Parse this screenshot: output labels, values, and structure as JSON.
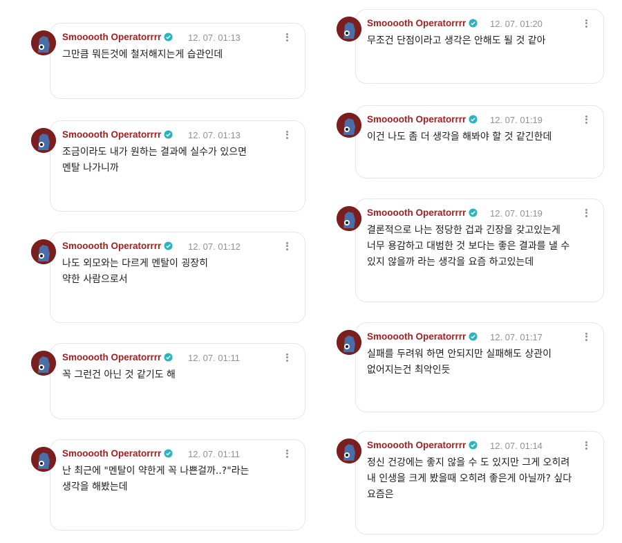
{
  "user": {
    "name": "Smooooth Operatorrrr"
  },
  "left_column": [
    {
      "time": "12. 07. 01:13",
      "text": "그만큼 뭐든것에 철저해지는게 습관인데"
    },
    {
      "time": "12. 07. 01:13",
      "text": "조금이라도 내가 원하는 결과에 실수가 있으면\n멘탈 나가니까"
    },
    {
      "time": "12. 07. 01:12",
      "text": "나도 외모와는 다르게 멘탈이 굉장히\n약한 사람으로서"
    },
    {
      "time": "12. 07. 01:11",
      "text": "꼭 그런건 아닌 것 같기도 해"
    },
    {
      "time": "12. 07. 01:11",
      "text": "난 최근에 \"멘탈이 약한게 꼭 나쁜걸까..?\"라는\n생각을 해봤는데"
    }
  ],
  "right_column": [
    {
      "time": "12. 07. 01:20",
      "text": "무조건 단점이라고 생각은 안해도 될 것 같아"
    },
    {
      "time": "12. 07. 01:19",
      "text": "이건 나도 좀 더 생각을 해봐야 할 것 같긴한데"
    },
    {
      "time": "12. 07. 01:19",
      "text": "결론적으로 나는 정당한 겁과 긴장을 갖고있는게\n너무 용감하고 대범한 것 보다는 좋은 결과를 낼 수\n있지 않을까 라는 생각을 요즘 하고있는데"
    },
    {
      "time": "12. 07. 01:17",
      "text": "실패를 두려워 하면 안되지만 실패해도 상관이\n없어지는건 최악인듯"
    },
    {
      "time": "12. 07. 01:14",
      "text": "정신 건강에는 좋지 않을 수 도 있지만 그게 오히려\n내 인생을 크게 봤을때 오히려 좋은게 아닐까? 싶다\n요즘은"
    }
  ],
  "colors": {
    "name": "#a31f1f",
    "verified": "#2bb3c0",
    "time": "#8c9096"
  },
  "icons": {
    "verified": "verified-badge-icon",
    "menu": "more-vertical-icon",
    "avatar": "avatar-icon"
  }
}
